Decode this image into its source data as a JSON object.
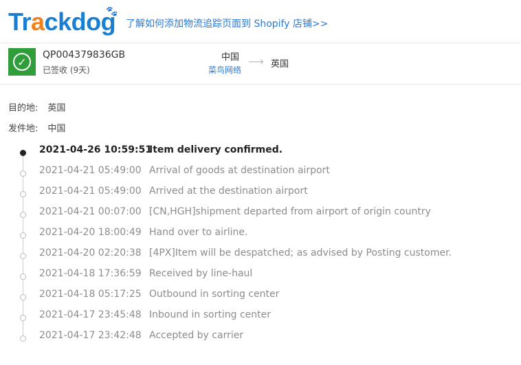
{
  "header": {
    "logo_text_parts": [
      "Tr",
      "a",
      "ckdog"
    ],
    "shopify_link": "了解如何添加物流追踪页面到 Shopify 店铺>>"
  },
  "shipment": {
    "tracking_number": "QP004379836GB",
    "status": "已签收 (9天)",
    "origin_country": "中国",
    "carrier": "菜鸟网络",
    "destination_country": "英国"
  },
  "details": {
    "destination_label": "目的地:",
    "destination_value": "英国",
    "origin_label": "发件地:",
    "origin_value": "中国"
  },
  "events": [
    {
      "time": "2021-04-26 10:59:51",
      "desc": "Item delivery confirmed."
    },
    {
      "time": "2021-04-21 05:49:00",
      "desc": "Arrival of goods at destination airport"
    },
    {
      "time": "2021-04-21 05:49:00",
      "desc": "Arrived at the destination airport"
    },
    {
      "time": "2021-04-21 00:07:00",
      "desc": "[CN,HGH]shipment departed from airport of origin country"
    },
    {
      "time": "2021-04-20 18:00:49",
      "desc": "Hand over to airline."
    },
    {
      "time": "2021-04-20 02:20:38",
      "desc": "[4PX]Item will be despatched; as advised by Posting customer."
    },
    {
      "time": "2021-04-18 17:36:59",
      "desc": "Received by line-haul"
    },
    {
      "time": "2021-04-18 05:17:25",
      "desc": "Outbound in sorting center"
    },
    {
      "time": "2021-04-17 23:45:48",
      "desc": "Inbound in sorting center"
    },
    {
      "time": "2021-04-17 23:42:48",
      "desc": "Accepted by carrier"
    }
  ],
  "colors": {
    "brand_blue": "#1b7fd1",
    "brand_orange": "#f0821e",
    "delivered_green": "#2e9d3a",
    "link_blue": "#2a7ad6"
  },
  "icons": {
    "status": "check-circle-icon",
    "route_arrow": "arrow-right-icon",
    "timeline_dot": "timeline-dot-icon"
  }
}
